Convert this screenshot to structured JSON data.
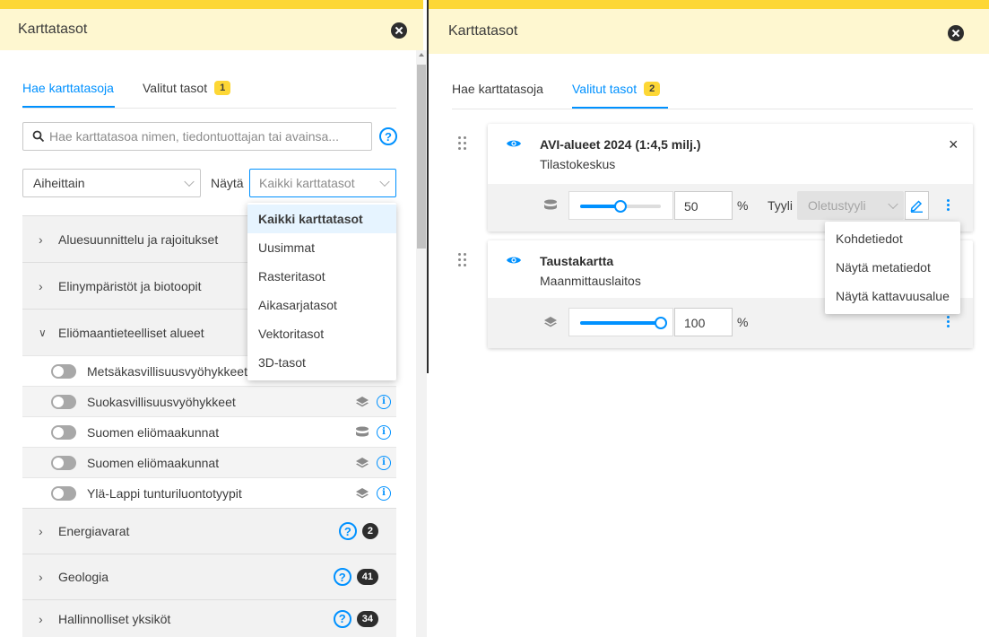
{
  "left_panel": {
    "title": "Karttatasot",
    "tabs": [
      {
        "label": "Hae karttatasoja",
        "active": true
      },
      {
        "label": "Valitut tasot",
        "badge": "1",
        "active": false
      }
    ],
    "search": {
      "placeholder": "Hae karttatasoa nimen, tiedontuottajan tai avainsa..."
    },
    "group_select": {
      "value": "Aiheittain"
    },
    "show_label": "Näytä",
    "show_select": {
      "value": "Kaikki karttatasot"
    },
    "dropdown_options": [
      "Kaikki karttatasot",
      "Uusimmat",
      "Rasteritasot",
      "Aikasarjatasot",
      "Vektoritasot",
      "3D-tasot"
    ],
    "groups": [
      {
        "label": "Aluesuunnittelu ja rajoitukset"
      },
      {
        "label": "Elinympäristöt ja biotoopit"
      },
      {
        "label": "Eliömaantieteelliset alueet",
        "expanded": true
      }
    ],
    "layers": [
      {
        "label": "Metsäkasvillisuusvyöhykkeet",
        "icon": "layers-icon"
      },
      {
        "label": "Suokasvillisuusvyöhykkeet",
        "icon": "layers-icon"
      },
      {
        "label": "Suomen eliömaakunnat",
        "icon": "database-icon"
      },
      {
        "label": "Suomen eliömaakunnat",
        "icon": "layers-icon"
      },
      {
        "label": "Ylä-Lappi tunturiluontotyypit",
        "icon": "layers-icon"
      }
    ],
    "groups_after": [
      {
        "label": "Energiavarat",
        "count": "2"
      },
      {
        "label": "Geologia",
        "count": "41"
      },
      {
        "label": "Hallinnolliset yksiköt",
        "count": "34"
      }
    ],
    "help_glyph": "?",
    "info_glyph": "i"
  },
  "right_panel": {
    "title": "Karttatasot",
    "tabs": [
      {
        "label": "Hae karttatasoja",
        "active": false
      },
      {
        "label": "Valitut tasot",
        "badge": "2",
        "active": true
      }
    ],
    "cards": [
      {
        "title": "AVI-alueet 2024 (1:4,5 milj.)",
        "provider": "Tilastokeskus",
        "opacity": "50",
        "opacity_fraction": 0.5,
        "percent": "%",
        "style_label": "Tyyli",
        "style_value": "Oletustyyli",
        "close_glyph": "×"
      },
      {
        "title": "Taustakartta",
        "provider": "Maanmittauslaitos",
        "opacity": "100",
        "opacity_fraction": 1.0,
        "percent": "%"
      }
    ],
    "menu_items": [
      "Kohdetiedot",
      "Näytä metatiedot",
      "Näytä kattavuusalue"
    ]
  },
  "colors": {
    "accent": "#0091ff",
    "yellow": "#fdd735",
    "header_bg": "#fef7d0"
  }
}
